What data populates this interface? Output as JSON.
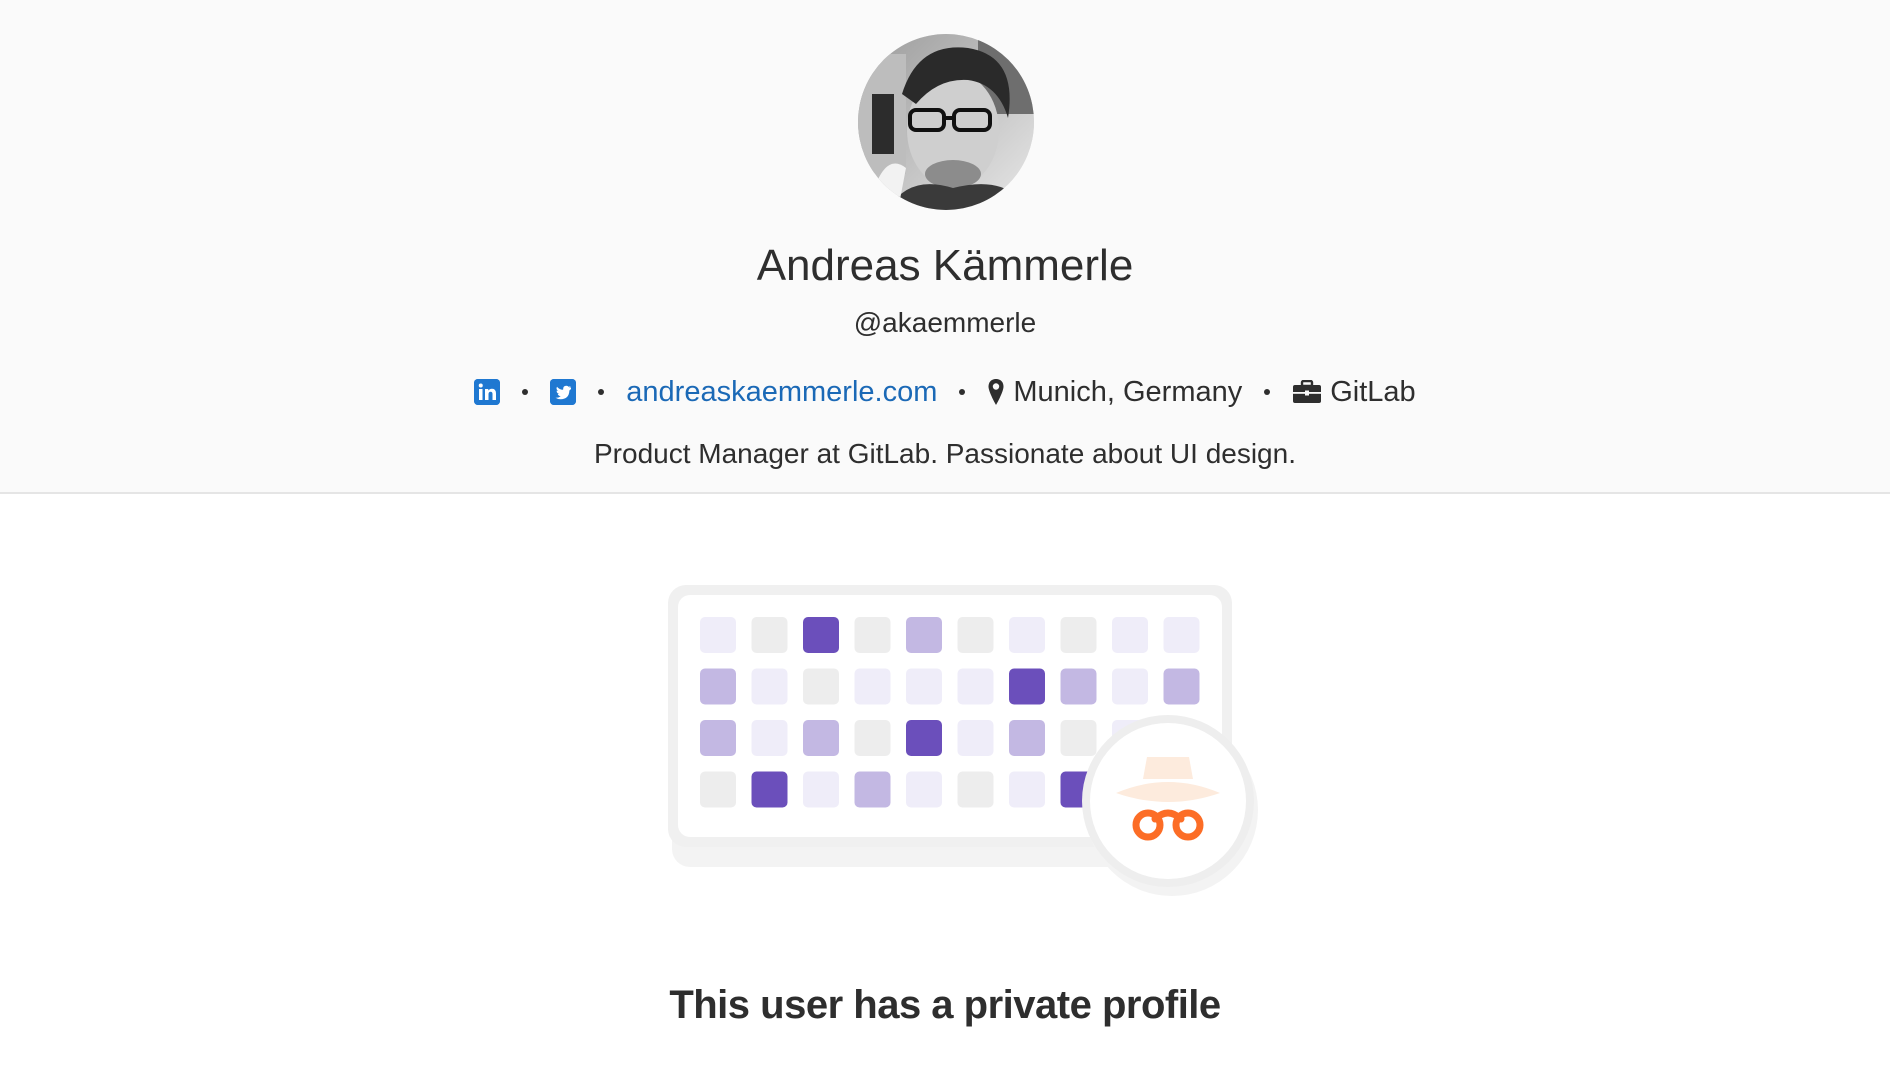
{
  "profile": {
    "name": "Andreas Kämmerle",
    "username": "@akaemmerle",
    "website": "andreaskaemmerle.com",
    "location": "Munich, Germany",
    "organization": "GitLab",
    "bio": "Product Manager at GitLab. Passionate about UI design.",
    "avatar_icon": "avatar-photo"
  },
  "social": {
    "linkedin_icon": "linkedin-icon",
    "twitter_icon": "twitter-icon"
  },
  "meta_icons": {
    "location": "map-marker-icon",
    "organization": "briefcase-icon"
  },
  "colors": {
    "link": "#1b69b6",
    "social_blue": "#1f78d1",
    "activity_dark": "#6b4fbb",
    "activity_mid": "#c3b8e3",
    "activity_light": "#efedf9",
    "activity_empty": "#ededed",
    "incognito_orange": "#fc6d26",
    "incognito_hat": "#fdebdd"
  },
  "empty_state": {
    "title": "This user has a private profile"
  }
}
